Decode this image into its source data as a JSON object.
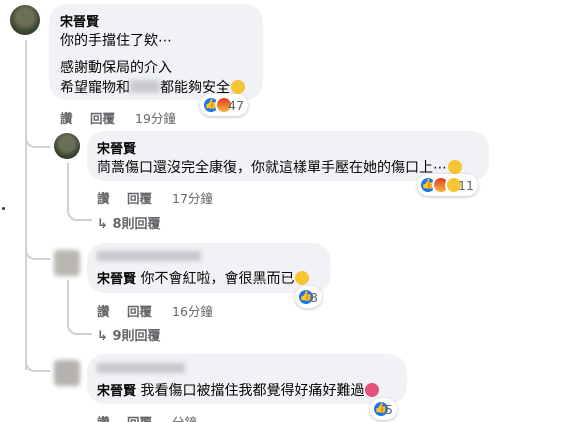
{
  "comment1": {
    "author": "宋晉賢",
    "lines": [
      "你的手擋住了欸⋯",
      "感謝動保局的介入",
      "希望寵物和",
      "都能夠安全"
    ],
    "reaction_count": "47",
    "actions": {
      "like": "讚",
      "reply": "回覆",
      "time": "19分鐘"
    }
  },
  "reply1": {
    "author": "宋晉賢",
    "text": "茼蒿傷口還沒完全康復，你就這樣單手壓在她的傷口上⋯",
    "reaction_count": "11",
    "actions": {
      "like": "讚",
      "reply": "回覆",
      "time": "17分鐘"
    },
    "more_replies": "8則回覆"
  },
  "reply2": {
    "author": "宋晉賢",
    "text": "你不會紅啦，會很黑而已",
    "reaction_count": "8",
    "actions": {
      "like": "讚",
      "reply": "回覆",
      "time": "16分鐘"
    },
    "more_replies": "9則回覆"
  },
  "reply3": {
    "author": "宋晉賢",
    "text": "我看傷口被擋住我都覺得好痛好難過",
    "reaction_count": "5",
    "actions": {
      "like": "讚",
      "reply": "回覆",
      "time": "分鐘"
    }
  },
  "icons": {
    "like": "thumbs-up-icon",
    "angry": "angry-face-icon",
    "wow": "wow-face-icon",
    "reply_arrow": "reply-arrow-icon"
  },
  "colors": {
    "like_blue": "#1877f2",
    "bubble_bg": "#f0f2f5",
    "meta_gray": "#65676b"
  }
}
